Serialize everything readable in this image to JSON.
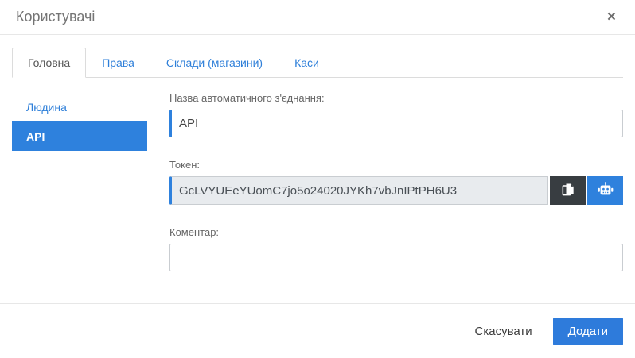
{
  "dialog": {
    "title": "Користувачі",
    "close_glyph": "×"
  },
  "tabs": [
    {
      "label": "Головна",
      "active": true
    },
    {
      "label": "Права",
      "active": false
    },
    {
      "label": "Склади (магазини)",
      "active": false
    },
    {
      "label": "Каси",
      "active": false
    }
  ],
  "sidebar": {
    "items": [
      {
        "label": "Людина",
        "active": false
      },
      {
        "label": "API",
        "active": true
      }
    ]
  },
  "form": {
    "name": {
      "label": "Назва автоматичного з'єднання:",
      "value": "API"
    },
    "token": {
      "label": "Токен:",
      "value": "GcLVYUEeYUomC7jo5o24020JYKh7vbJnIPtPH6U3",
      "copy_icon": "copy-icon",
      "generate_icon": "robot-icon"
    },
    "comment": {
      "label": "Коментар:",
      "value": ""
    }
  },
  "footer": {
    "cancel_label": "Скасувати",
    "submit_label": "Додати"
  },
  "colors": {
    "accent_blue": "#2e81dd",
    "primary_button": "#2e7bdb",
    "dark_button": "#383d41",
    "token_field_bg": "#e8ebee",
    "title_gray": "#757575",
    "link_blue": "#2e7fd9"
  }
}
